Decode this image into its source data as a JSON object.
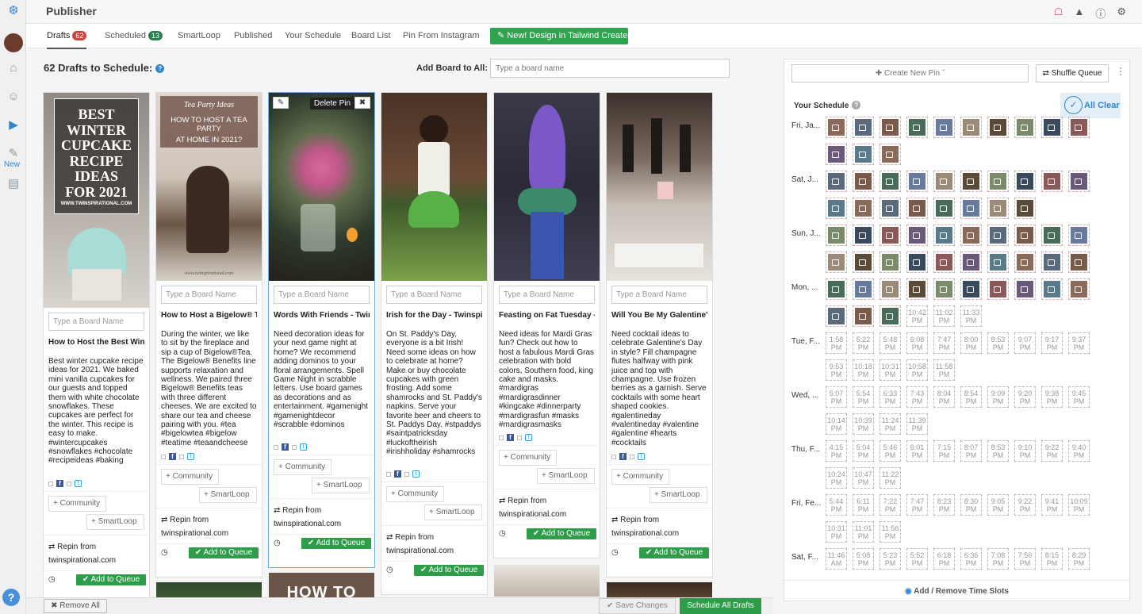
{
  "app": {
    "title": "Publisher",
    "rail_new": "New"
  },
  "tabs": [
    {
      "label": "Drafts",
      "badge": "62"
    },
    {
      "label": "Scheduled",
      "badge": "13"
    },
    {
      "label": "SmartLoop"
    },
    {
      "label": "Published"
    },
    {
      "label": "Your Schedule"
    },
    {
      "label": "Board List"
    },
    {
      "label": "Pin From Instagram"
    }
  ],
  "design_button": "New! Design in Tailwind Create",
  "drafts": {
    "heading": "62 Drafts to Schedule:",
    "add_board_label": "Add Board to All:",
    "add_board_placeholder": "Type a board name"
  },
  "card_common": {
    "board_placeholder": "Type a Board Name",
    "community": "+ Community",
    "smartloop": "+ SmartLoop",
    "repin_from": "Repin from",
    "add_to_queue": "Add to Queue"
  },
  "cards": [
    {
      "title": "How to Host the Best Winter Cupcake",
      "desc": "Best winter cupcake recipe ideas for 2021. We baked mini vanilla cupcakes for our guests and topped them with white chocolate snowflakes. These cupcakes are perfect for the winter. This recipe is easy to make. #wintercupcakes #snowflakes #chocolate #recipeideas #baking",
      "source": "twinspirational.com",
      "colors": [
        "#b0a9a2",
        "#8c8682"
      ]
    },
    {
      "title": "How to Host a Bigelow® Tea Party",
      "desc": "During the winter, we like to sit by the fireplace and sip a cup of Bigelow®Tea. The Bigelow® Benefits line supports relaxation and wellness. We paired three Bigelow® Benefits teas with three different cheeses. We are excited to share our tea and cheese pairing with you. #tea #bigelowtea #bigelow #teatime #teaandcheese",
      "source": "twinspirational.com",
      "colors": [
        "#d8cfc6",
        "#6e5a4a"
      ]
    },
    {
      "title": "Words With Friends - Twins Game Night",
      "desc": "Need decoration ideas for your next game night at home? We recommend adding dominos to your floral arrangements. Spell Game Night in scrabble letters. Use board games as decorations and as entertainment. #gamenight #gamenightdecor #scrabble #dominos",
      "source": "twinspirational.com",
      "colors": [
        "#3a4b3c",
        "#2a2a22"
      ],
      "delete_label": "Delete Pin"
    },
    {
      "title": "Irish for the Day - Twinspirational",
      "desc": "On St. Paddy's Day, everyone is a bit Irish! Need some ideas on how to celebrate at home? Make or buy chocolate cupcakes with green frosting. Add some shamrocks and St. Paddy's napkins. Serve your favorite beer and cheers to St. Paddys Day. #stpaddys #saintpatricksday #luckoftheirish #irishholiday #shamrocks",
      "source": "twinspirational.com",
      "colors": [
        "#5a3f2e",
        "#7b9a4a"
      ]
    },
    {
      "title": "Feasting on Fat Tuesday - Mardi Gras",
      "desc": "Need ideas for Mardi Gras fun? Check out how to host a fabulous Mardi Gras celebration with bold colors, Southern food, king cake and masks. #mardigras #mardigrasdinner #kingcake #dinnerparty #mardigrasfun #masks #mardigrasmasks",
      "source": "twinspirational.com",
      "colors": [
        "#2b2a3a",
        "#4e5c8a"
      ]
    },
    {
      "title": "Will You Be My Galentine's Day",
      "desc": "Need cocktail ideas to celebrate Galentine's Day in style? Fill champagne flutes halfway with pink juice and top with champagne. Use frozen berries as a garnish. Serve cocktails with some heart shaped cookies. #galentineday #valentineday #valentine #galentine #hearts #cocktails",
      "source": "twinspirational.com",
      "colors": [
        "#6b5a52",
        "#c8c2ba"
      ]
    }
  ],
  "pin_text": {
    "line1": "BEST",
    "line2": "WINTER",
    "line3": "CUPCAKE",
    "line4": "RECIPE",
    "line5": "IDEAS",
    "line6": "FOR 2021",
    "url": "WWW.TWINSPIRATIONAL.COM",
    "tea_script": "Tea Party Ideas",
    "tea_line1": "HOW TO HOST A TEA PARTY",
    "tea_line2": "AT HOME IN 2021?",
    "tea_url": "www.twinspirational.com",
    "how_to": "HOW TO"
  },
  "bottom_bar": {
    "remove_all": "Remove All",
    "save_changes": "Save Changes",
    "schedule_all": "Schedule All Drafts"
  },
  "schedule": {
    "create_new_pin": "Create New Pin",
    "shuffle_queue": "Shuffle Queue",
    "your_schedule": "Your Schedule",
    "all_clear": "All Clear",
    "add_remove": "Add / Remove Time Slots",
    "days": [
      {
        "label": "Fri, Ja...",
        "rows": [
          {
            "pins": 10,
            "times": []
          },
          {
            "pins": 3,
            "times": []
          }
        ]
      },
      {
        "label": "Sat, J...",
        "rows": [
          {
            "pins": 10,
            "times": []
          },
          {
            "pins": 8,
            "times": []
          }
        ]
      },
      {
        "label": "Sun, J...",
        "rows": [
          {
            "pins": 10,
            "times": []
          },
          {
            "pins": 10,
            "times": []
          }
        ]
      },
      {
        "label": "Mon, ...",
        "rows": [
          {
            "pins": 10,
            "times": []
          },
          {
            "pins": 3,
            "times": [
              "10:42 PM",
              "11:02 PM",
              "11:33 PM"
            ]
          }
        ]
      },
      {
        "label": "Tue, F...",
        "rows": [
          {
            "pins": 0,
            "times": [
              "1:58 PM",
              "5:22 PM",
              "5:48 PM",
              "6:08 PM",
              "7:47 PM",
              "8:00 PM",
              "8:53 PM",
              "9:07 PM",
              "9:17 PM",
              "9:37 PM"
            ]
          },
          {
            "pins": 0,
            "times": [
              "9:53 PM",
              "10:18 PM",
              "10:31 PM",
              "10:58 PM",
              "11:58 PM"
            ]
          }
        ]
      },
      {
        "label": "Wed, ...",
        "rows": [
          {
            "pins": 0,
            "times": [
              "5:07 PM",
              "5:54 PM",
              "6:33 PM",
              "7:43 PM",
              "8:04 PM",
              "8:54 PM",
              "9:09 PM",
              "9:20 PM",
              "9:38 PM",
              "9:45 PM"
            ]
          },
          {
            "pins": 0,
            "times": [
              "10:14 PM",
              "10:39 PM",
              "11:24 PM",
              "11:39 PM"
            ]
          }
        ]
      },
      {
        "label": "Thu, F...",
        "rows": [
          {
            "pins": 0,
            "times": [
              "4:15 PM",
              "5:04 PM",
              "5:46 PM",
              "6:01 PM",
              "7:15 PM",
              "8:07 PM",
              "8:53 PM",
              "9:10 PM",
              "9:22 PM",
              "9:40 PM"
            ]
          },
          {
            "pins": 0,
            "times": [
              "10:24 PM",
              "10:47 PM",
              "11:22 PM"
            ]
          }
        ]
      },
      {
        "label": "Fri, Fe...",
        "rows": [
          {
            "pins": 0,
            "times": [
              "5:44 PM",
              "6:11 PM",
              "7:22 PM",
              "7:47 PM",
              "8:23 PM",
              "8:30 PM",
              "9:05 PM",
              "9:22 PM",
              "9:41 PM",
              "10:09 PM"
            ]
          },
          {
            "pins": 0,
            "times": [
              "10:31 PM",
              "11:01 PM",
              "11:56 PM"
            ]
          }
        ]
      },
      {
        "label": "Sat, F...",
        "rows": [
          {
            "pins": 0,
            "times": [
              "11:46 AM",
              "5:08 PM",
              "5:23 PM",
              "5:52 PM",
              "6:18 PM",
              "6:36 PM",
              "7:08 PM",
              "7:56 PM",
              "8:15 PM",
              "8:29 PM"
            ]
          }
        ]
      }
    ]
  },
  "colors": {
    "accent": "#2e9d4a",
    "brand": "#2f86c8",
    "badge_red": "#c9473f"
  }
}
